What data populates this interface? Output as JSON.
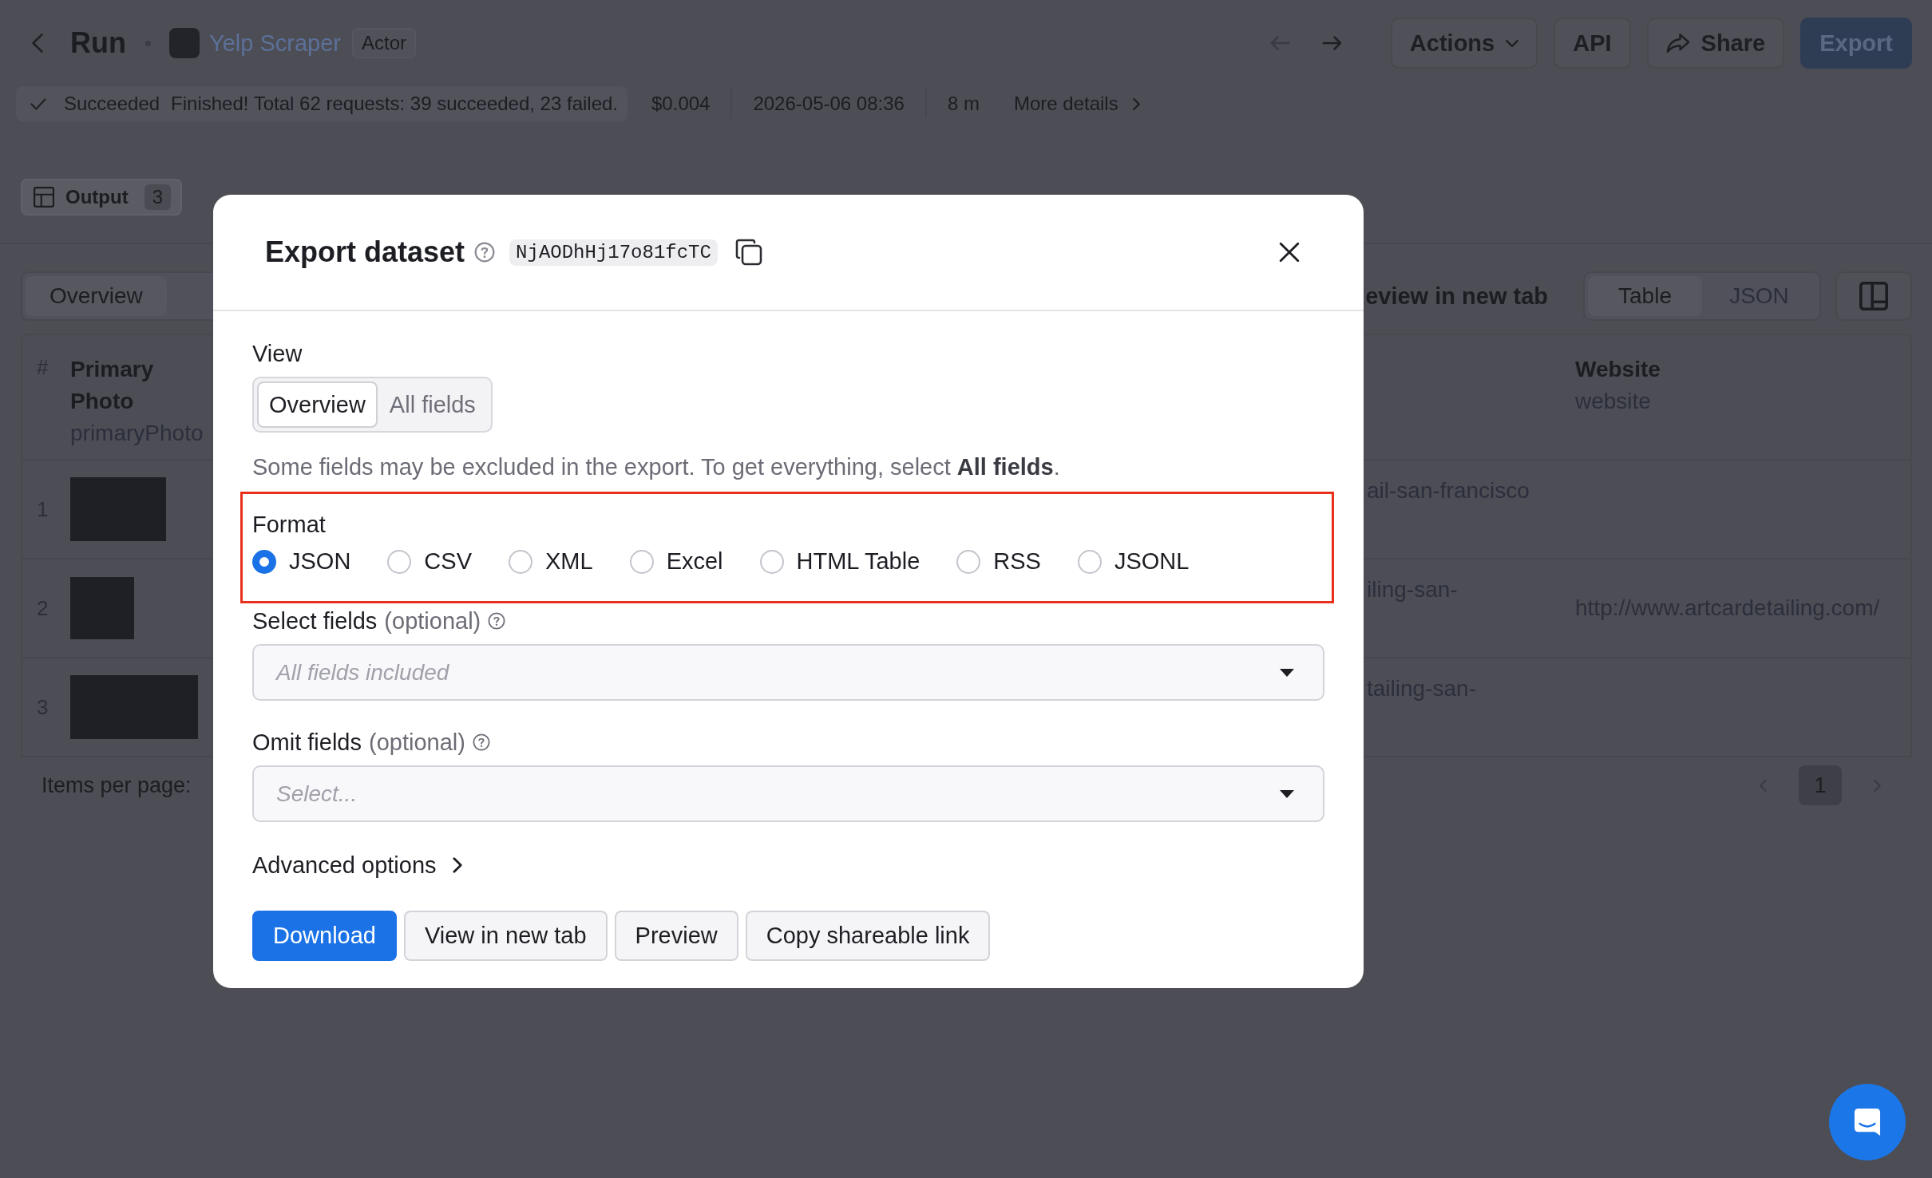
{
  "header": {
    "title": "Run",
    "actor": {
      "name": "Yelp Scraper",
      "badge": "Actor"
    },
    "history": [
      {
        "kind": "back",
        "disabled": true
      },
      {
        "kind": "forward",
        "disabled": false
      }
    ],
    "buttons": [
      {
        "label": "Actions",
        "kind": "menu"
      },
      {
        "label": "API",
        "kind": "plain"
      },
      {
        "label": "Share",
        "kind": "share"
      },
      {
        "label": "Export",
        "kind": "primary"
      }
    ]
  },
  "status_bar": {
    "status": "Succeeded",
    "message": "Finished! Total 62 requests: 39 succeeded, 23 failed.",
    "cost": "$0.004",
    "started": "2026-05-06 08:36",
    "duration": "8 m",
    "details_link": "More details"
  },
  "tabs": [
    {
      "label": "Output",
      "count": "3",
      "selected": true
    }
  ],
  "output_toolbar": {
    "views": [
      {
        "label": "Overview",
        "selected": true
      }
    ],
    "preview_link": "eview in new tab",
    "display_modes": [
      {
        "label": "Table",
        "selected": true
      },
      {
        "label": "JSON",
        "selected": false
      }
    ]
  },
  "table": {
    "columns": [
      {
        "label": "#"
      },
      {
        "label": "Primary Photo",
        "field": "primaryPhoto"
      },
      {
        "label": "Website",
        "field": "website"
      }
    ],
    "rows": [
      {
        "index": "1",
        "column_3": "ail-san-francisco"
      },
      {
        "index": "2",
        "column_3": "iling-san-",
        "website": "http://www.artcardetailing.com/"
      },
      {
        "index": "3",
        "column_3": "tailing-san-"
      }
    ]
  },
  "pagination": {
    "items_per_page_label": "Items per page:",
    "pages": [
      {
        "label": "1",
        "selected": true
      }
    ]
  },
  "dialog": {
    "title": "Export dataset",
    "dataset_id": "NjAODhHj17o81fcTC",
    "view": {
      "label": "View",
      "options": [
        {
          "label": "Overview",
          "selected": true
        },
        {
          "label": "All fields",
          "selected": false
        }
      ]
    },
    "hint": "Some fields may be excluded in the export. To get everything, select **All fields**.",
    "format": {
      "label": "Format",
      "highlighted": true,
      "options": [
        {
          "label": "JSON",
          "selected": true
        },
        {
          "label": "CSV",
          "selected": false
        },
        {
          "label": "XML",
          "selected": false
        },
        {
          "label": "Excel",
          "selected": false
        },
        {
          "label": "HTML Table",
          "selected": false
        },
        {
          "label": "RSS",
          "selected": false
        },
        {
          "label": "JSONL",
          "selected": false
        }
      ]
    },
    "selects": [
      {
        "label": "Select fields",
        "note": "(optional)",
        "placeholder": "All fields included"
      },
      {
        "label": "Omit fields",
        "note": "(optional)",
        "placeholder": "Select..."
      }
    ],
    "advanced_options": {
      "label": "Advanced options",
      "expanded": false
    },
    "buttons": [
      {
        "label": "Download",
        "kind": "primary"
      },
      {
        "label": "View in new tab",
        "kind": "secondary"
      },
      {
        "label": "Preview",
        "kind": "secondary"
      },
      {
        "label": "Copy shareable link",
        "kind": "secondary"
      }
    ]
  }
}
